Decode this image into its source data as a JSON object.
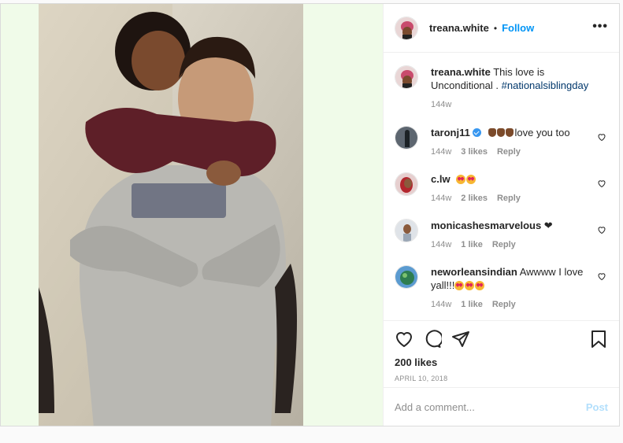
{
  "header": {
    "username": "treana.white",
    "separator": "•",
    "follow_label": "Follow",
    "more_label": "•••"
  },
  "caption": {
    "username": "treana.white",
    "text": " This love is Unconditional . ",
    "hashtag": "#nationalsiblingday",
    "time": "144w"
  },
  "comments": [
    {
      "username": "taronj11",
      "verified": true,
      "text": "love you too",
      "time": "144w",
      "likes": "3 likes",
      "reply": "Reply"
    },
    {
      "username": "c.lw",
      "text": "",
      "time": "144w",
      "likes": "2 likes",
      "reply": "Reply"
    },
    {
      "username": "monicashesmarvelous",
      "text": " ❤",
      "time": "144w",
      "likes": "1 like",
      "reply": "Reply"
    },
    {
      "username": "neworleansindian",
      "text": " Awwww I love yall!!!",
      "time": "144w",
      "likes": "1 like",
      "reply": "Reply"
    }
  ],
  "actions": {
    "likes": "200 likes",
    "date": "APRIL 10, 2018"
  },
  "add_comment": {
    "placeholder": "Add a comment...",
    "post_label": "Post"
  },
  "colors": {
    "accent": "#0095f6",
    "hashtag": "#00376b",
    "verified": "#3897f0",
    "media_bg": "#f0fbe9"
  },
  "icons": [
    "heart-icon",
    "comment-icon",
    "share-icon",
    "bookmark-icon",
    "more-icon",
    "verified-icon"
  ]
}
